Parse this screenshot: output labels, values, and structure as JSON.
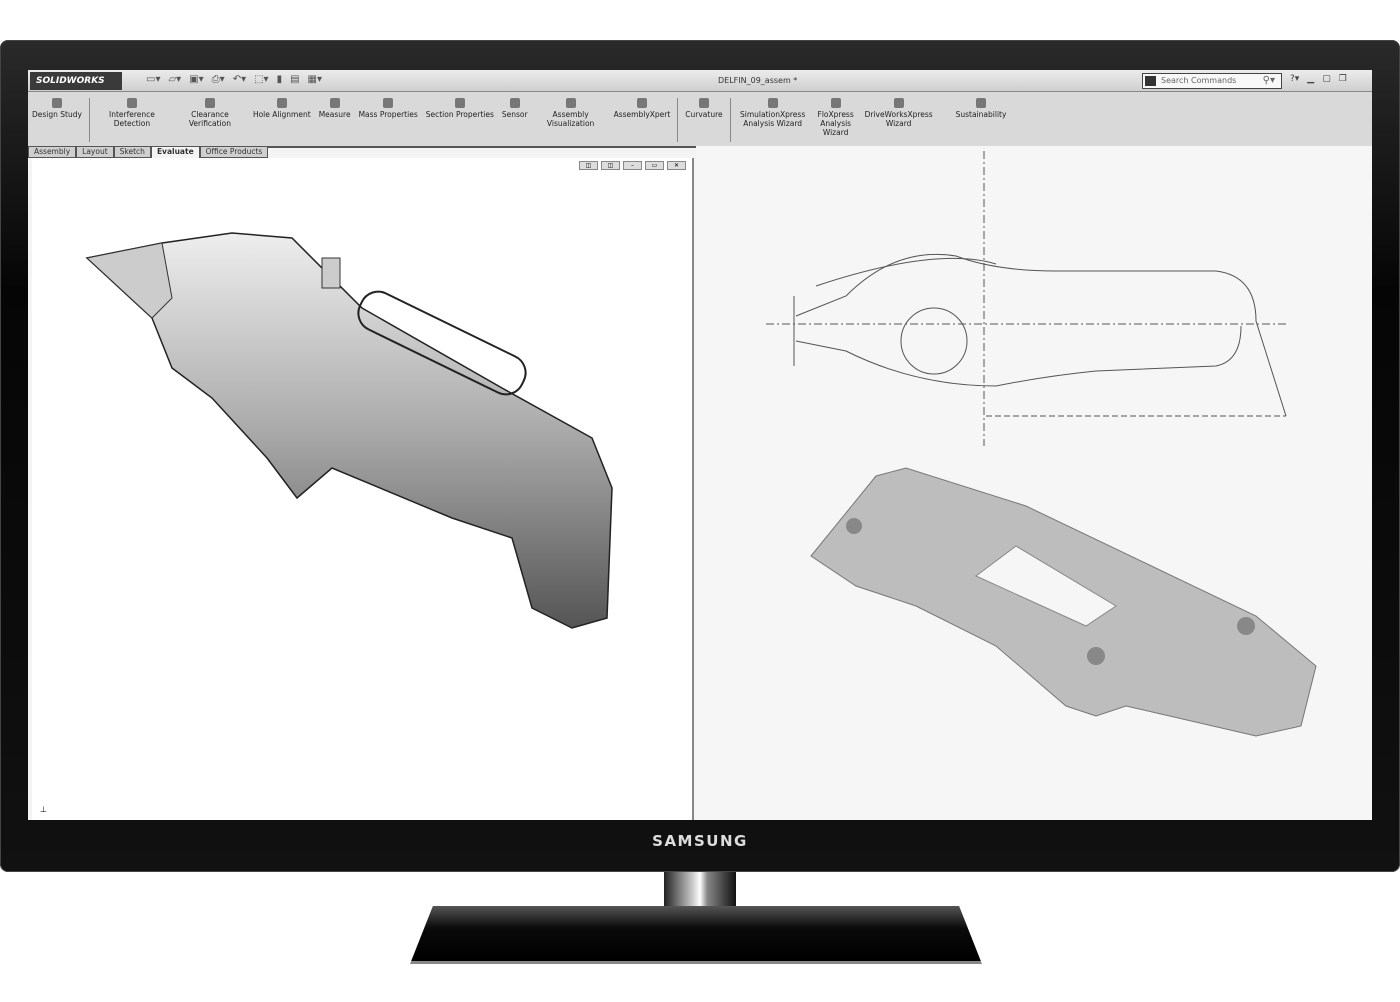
{
  "app": {
    "logo": "SOLIDWORKS",
    "document_title": "DELFIN_09_assem *",
    "search_placeholder": "Search Commands"
  },
  "ribbon": {
    "items": [
      {
        "label": "Design Study",
        "icon": "design-study-icon"
      },
      {
        "label": "Interference Detection",
        "icon": "interference-icon"
      },
      {
        "label": "Clearance Verification",
        "icon": "clearance-icon"
      },
      {
        "label": "Hole Alignment",
        "icon": "hole-alignment-icon"
      },
      {
        "label": "Measure",
        "icon": "measure-icon"
      },
      {
        "label": "Mass Properties",
        "icon": "mass-properties-icon"
      },
      {
        "label": "Section Properties",
        "icon": "section-properties-icon"
      },
      {
        "label": "Sensor",
        "icon": "sensor-icon"
      },
      {
        "label": "Assembly Visualization",
        "icon": "assembly-visualization-icon"
      },
      {
        "label": "AssemblyXpert",
        "icon": "assemblyxpert-icon"
      },
      {
        "label": "Curvature",
        "icon": "curvature-icon"
      },
      {
        "label": "SimulationXpress Analysis Wizard",
        "icon": "simulation-icon"
      },
      {
        "label": "FloXpress Analysis Wizard",
        "icon": "floxpress-icon"
      },
      {
        "label": "DriveWorksXpress Wizard",
        "icon": "driveworks-icon"
      },
      {
        "label": "Sustainability",
        "icon": "sustainability-icon"
      }
    ]
  },
  "tabs": [
    {
      "label": "Assembly"
    },
    {
      "label": "Layout"
    },
    {
      "label": "Sketch"
    },
    {
      "label": "Evaluate",
      "active": true
    },
    {
      "label": "Office Products"
    }
  ],
  "monitor": {
    "brand": "SAMSUNG"
  }
}
